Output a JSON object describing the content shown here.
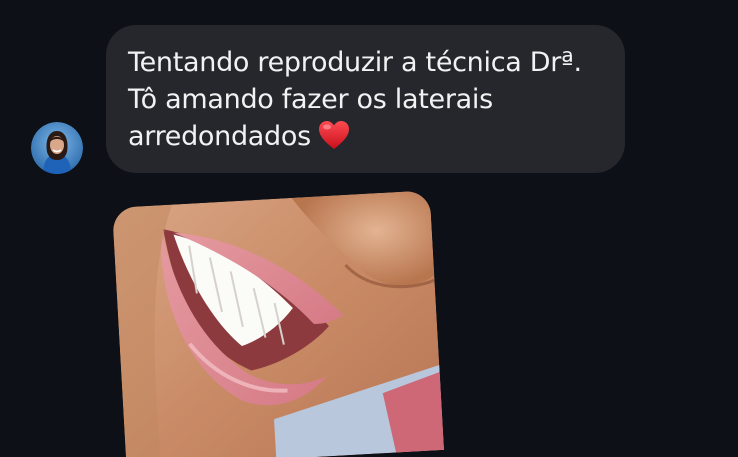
{
  "message": {
    "text": "Tentando reproduzir a técnica Drª.\nTô amando fazer os laterais\narredondados",
    "emoji_icon": "red-heart-icon"
  },
  "sender": {
    "avatar_icon": "user-avatar"
  },
  "attachment": {
    "type": "photo",
    "subject": "smile-closeup-photo"
  },
  "colors": {
    "background": "#0d1016",
    "bubble": "#25272c",
    "text": "#f1f2f4",
    "heart": "#e0242f"
  }
}
